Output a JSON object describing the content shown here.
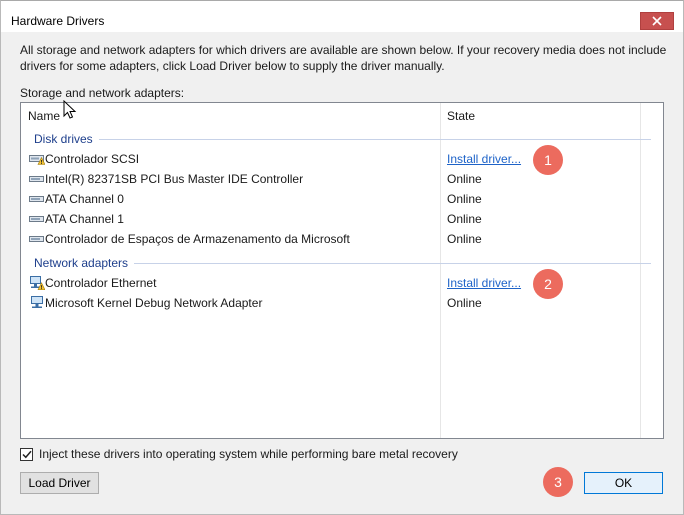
{
  "window": {
    "title": "Hardware Drivers"
  },
  "description": "All storage and network adapters for which drivers are available are shown below. If your recovery media does not include drivers for some adapters, click Load Driver below to supply the driver manually.",
  "list": {
    "label": "Storage and network adapters:",
    "columns": {
      "name": "Name",
      "state": "State"
    },
    "groups": [
      {
        "title": "Disk drives",
        "items": [
          {
            "name": "Controlador SCSI",
            "state": "Install driver...",
            "icon": "warning-storage-icon"
          },
          {
            "name": "Intel(R) 82371SB PCI Bus Master IDE Controller",
            "state": "Online",
            "icon": "storage-controller-icon"
          },
          {
            "name": "ATA Channel 0",
            "state": "Online",
            "icon": "storage-controller-icon"
          },
          {
            "name": "ATA Channel 1",
            "state": "Online",
            "icon": "storage-controller-icon"
          },
          {
            "name": "Controlador de Espaços de Armazenamento da Microsoft",
            "state": "Online",
            "icon": "storage-controller-icon"
          }
        ]
      },
      {
        "title": "Network adapters",
        "items": [
          {
            "name": "Controlador Ethernet",
            "state": "Install driver...",
            "icon": "warning-network-icon"
          },
          {
            "name": "Microsoft Kernel Debug Network Adapter",
            "state": "Online",
            "icon": "network-adapter-icon"
          }
        ]
      }
    ]
  },
  "badges": [
    "1",
    "2",
    "3"
  ],
  "inject_checkbox": {
    "label": "Inject these drivers into operating system while performing bare metal recovery",
    "checked": true
  },
  "buttons": {
    "load_driver": "Load Driver",
    "ok": "OK"
  },
  "colors": {
    "accent_link": "#1e63c8",
    "group_header": "#1e3f8c",
    "badge": "#ec6b5e",
    "close_button": "#c7504f"
  }
}
